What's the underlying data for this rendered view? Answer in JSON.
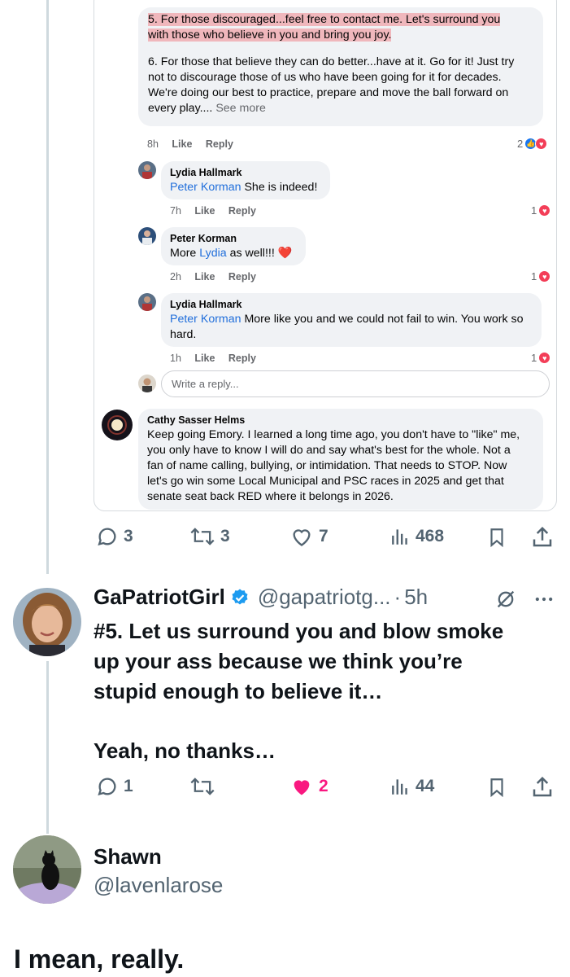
{
  "fb_card": {
    "main_comment": {
      "highlighted_line1": "5. For those discouraged...feel free to contact me.  Let's surround you",
      "highlighted_line2": "with those who believe in you and bring you joy.",
      "para6_line1": "6. For those that believe they can do better...have at it.  Go for it!  Just try",
      "para6_line2": "not to discourage those of us who have been going for it for decades.",
      "para6_line3": "We're doing our best to practice, prepare and move the ball forward on",
      "para6_line4": "every play....",
      "see_more": "See more",
      "time": "8h",
      "like": "Like",
      "reply": "Reply",
      "reaction_count": "2"
    },
    "replies": [
      {
        "author": "Lydia Hallmark",
        "mention": "Peter Korman",
        "text": " She is indeed!",
        "time": "7h",
        "like": "Like",
        "reply": "Reply",
        "count": "1"
      },
      {
        "author": "Peter Korman",
        "pre": "More ",
        "mention": "Lydia",
        "text": " as well!!! ",
        "emoji": "❤️",
        "time": "2h",
        "like": "Like",
        "reply": "Reply",
        "count": "1"
      },
      {
        "author": "Lydia Hallmark",
        "mention": "Peter Korman",
        "text_line1": " More like you and we could not fail to win. You work so",
        "text_line2": "hard.",
        "time": "1h",
        "like": "Like",
        "reply": "Reply",
        "count": "1"
      }
    ],
    "reply_placeholder": "Write a reply...",
    "cathy": {
      "author": "Cathy Sasser Helms",
      "line1": "Keep going Emory.  I learned a long time ago, you don't have to \"like\" me,",
      "line2": "you only have to know I will do and say what's best for the whole.  Not a",
      "line3": "fan of name calling, bullying, or intimidation.  That needs to STOP.  Now",
      "line4": "let's go win some Local Municipal and PSC races in 2025 and get that",
      "line5": "senate seat back RED where it belongs in 2026."
    }
  },
  "quoted_actions": {
    "replies": "3",
    "retweets": "3",
    "likes": "7",
    "views": "468"
  },
  "tweet": {
    "name": "GaPatriotGirl",
    "handle": "@gapatriotg...",
    "dot": "·",
    "time": "5h",
    "body_line1": "#5. Let us surround you and blow smoke",
    "body_line2": "up your ass because we think you’re",
    "body_line3": "stupid enough to believe it…",
    "body_line4": "Yeah, no thanks…",
    "actions": {
      "replies": "1",
      "retweets": "",
      "likes": "2",
      "views": "44"
    }
  },
  "reply_tweet": {
    "name": "Shawn",
    "handle": "@lavenlarose",
    "text": "I mean, really."
  },
  "colors": {
    "x_blue": "#1d9bf0",
    "like_pink": "#f91880",
    "fb_link": "#216fdb",
    "fb_bubble": "#f0f2f5",
    "muted": "#536471"
  }
}
